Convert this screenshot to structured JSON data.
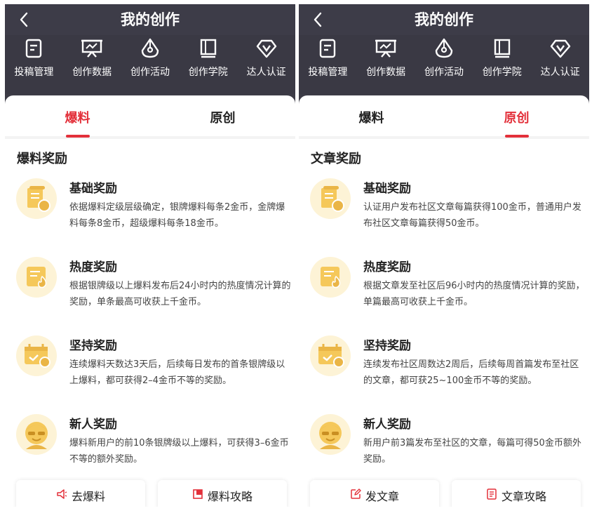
{
  "colors": {
    "accent": "#e3303a",
    "header_bg": "#3c3b46",
    "badge_gold": "#f5c85a"
  },
  "panels": [
    {
      "title": "我的创作",
      "nav": [
        {
          "label": "投稿管理",
          "icon": "document-edit-icon"
        },
        {
          "label": "创作数据",
          "icon": "chart-board-icon"
        },
        {
          "label": "创作活动",
          "icon": "pen-nib-icon"
        },
        {
          "label": "创作学院",
          "icon": "book-icon"
        },
        {
          "label": "达人认证",
          "icon": "diamond-v-icon"
        }
      ],
      "tabs": [
        {
          "label": "爆料",
          "active": true
        },
        {
          "label": "原创",
          "active": false
        }
      ],
      "section_title": "爆料奖励",
      "rewards": [
        {
          "name": "基础奖励",
          "desc": "依据爆料定级层级确定，银牌爆料每条2金币，金牌爆料每条8金币，超级爆料每条18金币。",
          "icon": "scroll-coin-icon"
        },
        {
          "name": "热度奖励",
          "desc": "根据银牌级以上爆料发布后24小时内的热度情况计算的奖励，单条最高可收获上千金币。",
          "icon": "flame-document-icon"
        },
        {
          "name": "坚持奖励",
          "desc": "连续爆料天数达3天后，后续每日发布的首条银牌级以上爆料，都可获得2–4金币不等的奖励。",
          "icon": "calendar-check-icon"
        },
        {
          "name": "新人奖励",
          "desc": "爆料新用户的前10条银牌级以上爆料，可获得3–6金币不等的额外奖励。",
          "icon": "newcomer-avatar-icon"
        }
      ],
      "actions": [
        {
          "label": "去爆料",
          "icon": "megaphone-icon"
        },
        {
          "label": "爆料攻略",
          "icon": "guide-book-icon"
        }
      ]
    },
    {
      "title": "我的创作",
      "nav": [
        {
          "label": "投稿管理",
          "icon": "document-edit-icon"
        },
        {
          "label": "创作数据",
          "icon": "chart-board-icon"
        },
        {
          "label": "创作活动",
          "icon": "pen-nib-icon"
        },
        {
          "label": "创作学院",
          "icon": "book-icon"
        },
        {
          "label": "达人认证",
          "icon": "diamond-v-icon"
        }
      ],
      "tabs": [
        {
          "label": "爆料",
          "active": false
        },
        {
          "label": "原创",
          "active": true
        }
      ],
      "section_title": "文章奖励",
      "rewards": [
        {
          "name": "基础奖励",
          "desc": "认证用户发布社区文章每篇获得100金币，普通用户发布社区文章每篇获得50金币。",
          "icon": "scroll-coin-icon"
        },
        {
          "name": "热度奖励",
          "desc": "根据文章发至社区后96小时内的热度情况计算的奖励，单篇最高可收获上千金币。",
          "icon": "flame-document-icon"
        },
        {
          "name": "坚持奖励",
          "desc": "连续发布社区周数达2周后，后续每周首篇发布至社区的文章，都可获25~100金币不等的奖励。",
          "icon": "calendar-check-icon"
        },
        {
          "name": "新人奖励",
          "desc": "新用户前3篇发布至社区的文章，每篇可得50金币额外奖励。",
          "icon": "newcomer-avatar-icon"
        }
      ],
      "actions": [
        {
          "label": "发文章",
          "icon": "edit-square-icon"
        },
        {
          "label": "文章攻略",
          "icon": "guide-list-icon"
        }
      ]
    }
  ]
}
